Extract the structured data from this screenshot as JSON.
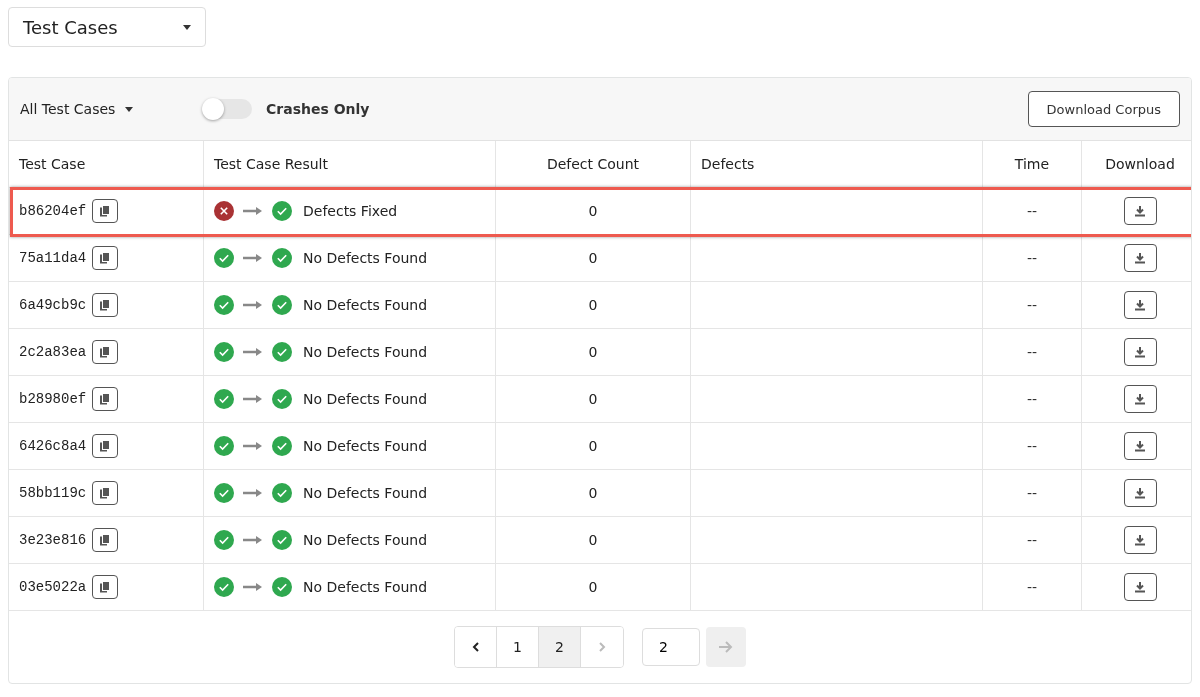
{
  "view_select": {
    "label": "Test Cases"
  },
  "toolbar": {
    "filter": "All Test Cases",
    "toggle": {
      "label": "Crashes Only",
      "on": false
    },
    "download_corpus": "Download Corpus"
  },
  "table": {
    "columns": [
      "Test Case",
      "Test Case Result",
      "Defect Count",
      "Defects",
      "Time",
      "Download"
    ],
    "rows": [
      {
        "id": "b86204ef",
        "before_passed": false,
        "after_passed": true,
        "result": "Defects Fixed",
        "defect_count": "0",
        "time": "--",
        "highlighted": true
      },
      {
        "id": "75a11da4",
        "before_passed": true,
        "after_passed": true,
        "result": "No Defects Found",
        "defect_count": "0",
        "time": "--",
        "highlighted": false
      },
      {
        "id": "6a49cb9c",
        "before_passed": true,
        "after_passed": true,
        "result": "No Defects Found",
        "defect_count": "0",
        "time": "--",
        "highlighted": false
      },
      {
        "id": "2c2a83ea",
        "before_passed": true,
        "after_passed": true,
        "result": "No Defects Found",
        "defect_count": "0",
        "time": "--",
        "highlighted": false
      },
      {
        "id": "b28980ef",
        "before_passed": true,
        "after_passed": true,
        "result": "No Defects Found",
        "defect_count": "0",
        "time": "--",
        "highlighted": false
      },
      {
        "id": "6426c8a4",
        "before_passed": true,
        "after_passed": true,
        "result": "No Defects Found",
        "defect_count": "0",
        "time": "--",
        "highlighted": false
      },
      {
        "id": "58bb119c",
        "before_passed": true,
        "after_passed": true,
        "result": "No Defects Found",
        "defect_count": "0",
        "time": "--",
        "highlighted": false
      },
      {
        "id": "3e23e816",
        "before_passed": true,
        "after_passed": true,
        "result": "No Defects Found",
        "defect_count": "0",
        "time": "--",
        "highlighted": false
      },
      {
        "id": "03e5022a",
        "before_passed": true,
        "after_passed": true,
        "result": "No Defects Found",
        "defect_count": "0",
        "time": "--",
        "highlighted": false
      }
    ]
  },
  "pagination": {
    "prev_disabled": false,
    "next_disabled": true,
    "pages": [
      {
        "label": "1",
        "selected": false
      },
      {
        "label": "2",
        "selected": true
      }
    ],
    "jump_value": "2",
    "go_disabled": true
  }
}
